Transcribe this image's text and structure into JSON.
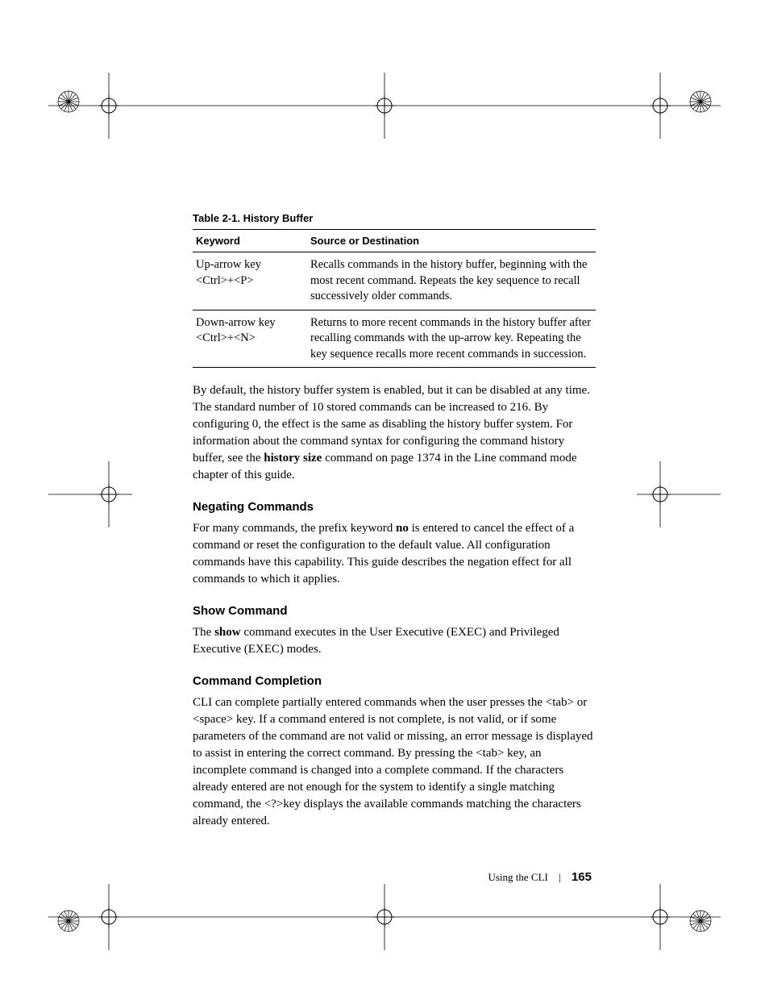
{
  "table": {
    "caption": "Table 2-1.   History Buffer",
    "headers": [
      "Keyword",
      "Source or Destination"
    ],
    "rows": [
      {
        "key1": "Up-arrow key",
        "key2": "<Ctrl>+<P>",
        "desc": "Recalls commands in the history buffer, beginning with the most recent command. Repeats the key sequence to recall successively older commands."
      },
      {
        "key1": "Down-arrow key",
        "key2": "<Ctrl>+<N>",
        "desc": "Returns to more recent commands in the history buffer after recalling commands with the up-arrow key. Repeating the key sequence recalls more recent commands in succession."
      }
    ]
  },
  "para1a": "By default, the history buffer system is enabled, but it can be disabled at any time. The standard number of 10 stored commands can be increased to 216. By configuring 0, the effect is the same as disabling the history buffer system. For information about the command syntax for configuring the command history buffer, see the ",
  "para1b": "history size",
  "para1c": " command on page 1374  in the Line command mode chapter of this guide.",
  "sec1": {
    "title": "Negating Commands",
    "a": "For many commands, the prefix keyword ",
    "b": "no",
    "c": " is entered to cancel the effect of a command or reset the configuration to the default value. All configuration commands have this capability. This guide describes the negation effect for all commands to which it applies."
  },
  "sec2": {
    "title": "Show Command",
    "a": "The ",
    "b": "show",
    "c": " command executes in the User Executive (EXEC) and Privileged Executive (EXEC) modes."
  },
  "sec3": {
    "title": "Command Completion",
    "body": "CLI can complete partially entered commands when the user presses the <tab> or <space> key. If a command entered is not complete, is not valid, or if some parameters of the command are not valid or missing, an error message is displayed to assist in entering the correct command. By pressing the <tab> key, an incomplete command is changed into a complete command. If the characters already entered are not enough for the system to identify a single matching command, the <?>key displays the available commands matching the characters already entered."
  },
  "footer": {
    "section": "Using the CLI",
    "page": "165"
  }
}
